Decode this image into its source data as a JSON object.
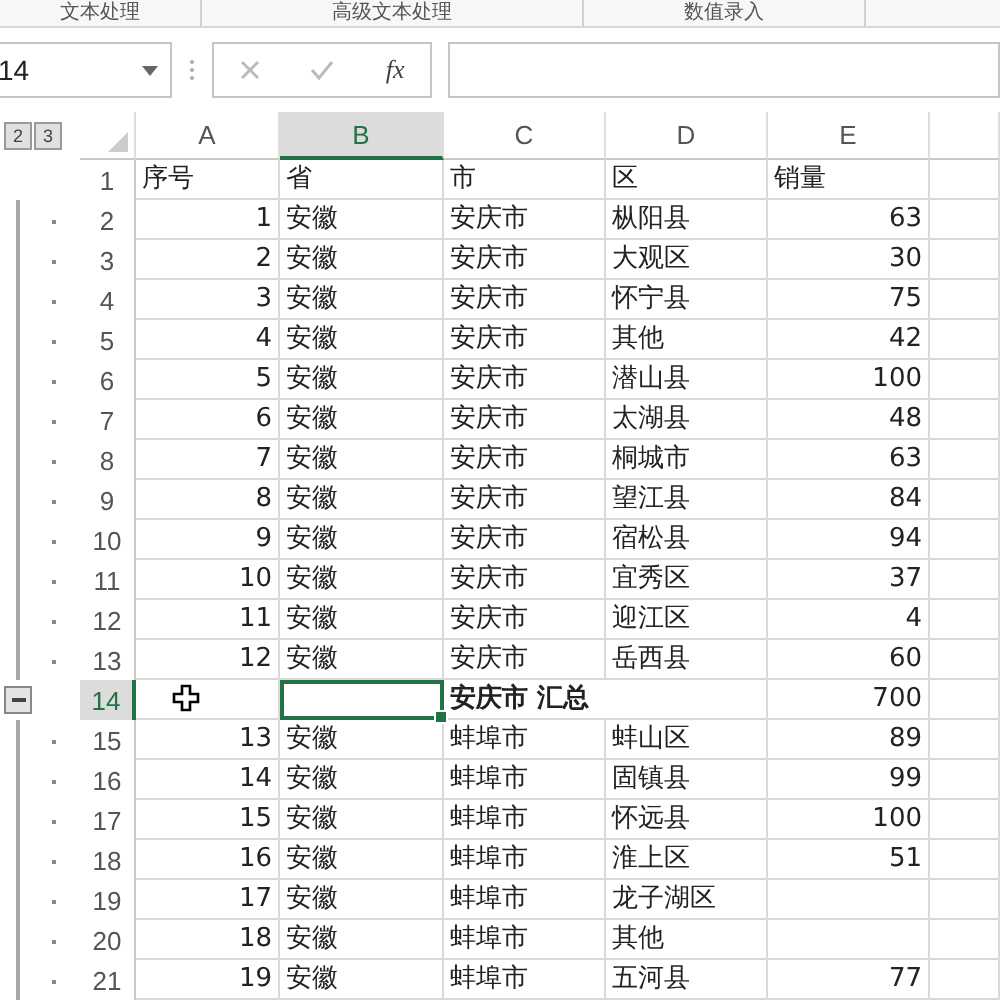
{
  "ribbon_groups": [
    "文本处理",
    "高级文本处理",
    "数值录入"
  ],
  "formula_bar": {
    "name_box": "14",
    "function_label": "fx"
  },
  "outline_levels": [
    "2",
    "3"
  ],
  "columns": [
    {
      "label": "A",
      "selected": false
    },
    {
      "label": "B",
      "selected": true
    },
    {
      "label": "C",
      "selected": false
    },
    {
      "label": "D",
      "selected": false
    },
    {
      "label": "E",
      "selected": false
    }
  ],
  "rows": [
    {
      "n": "1",
      "kind": "header",
      "selected": false,
      "a": "序号",
      "b": "省",
      "c": "市",
      "d": "区",
      "e": "销量"
    },
    {
      "n": "2",
      "kind": "detail",
      "selected": false,
      "a": "1",
      "b": "安徽",
      "c": "安庆市",
      "d": "枞阳县",
      "e": "63"
    },
    {
      "n": "3",
      "kind": "detail",
      "selected": false,
      "a": "2",
      "b": "安徽",
      "c": "安庆市",
      "d": "大观区",
      "e": "30"
    },
    {
      "n": "4",
      "kind": "detail",
      "selected": false,
      "a": "3",
      "b": "安徽",
      "c": "安庆市",
      "d": "怀宁县",
      "e": "75"
    },
    {
      "n": "5",
      "kind": "detail",
      "selected": false,
      "a": "4",
      "b": "安徽",
      "c": "安庆市",
      "d": "其他",
      "e": "42"
    },
    {
      "n": "6",
      "kind": "detail",
      "selected": false,
      "a": "5",
      "b": "安徽",
      "c": "安庆市",
      "d": "潜山县",
      "e": "100"
    },
    {
      "n": "7",
      "kind": "detail",
      "selected": false,
      "a": "6",
      "b": "安徽",
      "c": "安庆市",
      "d": "太湖县",
      "e": "48"
    },
    {
      "n": "8",
      "kind": "detail",
      "selected": false,
      "a": "7",
      "b": "安徽",
      "c": "安庆市",
      "d": "桐城市",
      "e": "63"
    },
    {
      "n": "9",
      "kind": "detail",
      "selected": false,
      "a": "8",
      "b": "安徽",
      "c": "安庆市",
      "d": "望江县",
      "e": "84"
    },
    {
      "n": "10",
      "kind": "detail",
      "selected": false,
      "a": "9",
      "b": "安徽",
      "c": "安庆市",
      "d": "宿松县",
      "e": "94"
    },
    {
      "n": "11",
      "kind": "detail",
      "selected": false,
      "a": "10",
      "b": "安徽",
      "c": "安庆市",
      "d": "宜秀区",
      "e": "37"
    },
    {
      "n": "12",
      "kind": "detail",
      "selected": false,
      "a": "11",
      "b": "安徽",
      "c": "安庆市",
      "d": "迎江区",
      "e": "4"
    },
    {
      "n": "13",
      "kind": "detail",
      "selected": false,
      "a": "12",
      "b": "安徽",
      "c": "安庆市",
      "d": "岳西县",
      "e": "60"
    },
    {
      "n": "14",
      "kind": "subtotal",
      "selected": true,
      "c": "安庆市 汇总",
      "e": "700"
    },
    {
      "n": "15",
      "kind": "detail",
      "selected": false,
      "a": "13",
      "b": "安徽",
      "c": "蚌埠市",
      "d": "蚌山区",
      "e": "89"
    },
    {
      "n": "16",
      "kind": "detail",
      "selected": false,
      "a": "14",
      "b": "安徽",
      "c": "蚌埠市",
      "d": "固镇县",
      "e": "99"
    },
    {
      "n": "17",
      "kind": "detail",
      "selected": false,
      "a": "15",
      "b": "安徽",
      "c": "蚌埠市",
      "d": "怀远县",
      "e": "100"
    },
    {
      "n": "18",
      "kind": "detail",
      "selected": false,
      "a": "16",
      "b": "安徽",
      "c": "蚌埠市",
      "d": "淮上区",
      "e": "51"
    },
    {
      "n": "19",
      "kind": "detail",
      "selected": false,
      "a": "17",
      "b": "安徽",
      "c": "蚌埠市",
      "d": "龙子湖区"
    },
    {
      "n": "20",
      "kind": "detail",
      "selected": false,
      "a": "18",
      "b": "安徽",
      "c": "蚌埠市",
      "d": "其他"
    },
    {
      "n": "21",
      "kind": "detail",
      "selected": false,
      "a": "19",
      "b": "安徽",
      "c": "蚌埠市",
      "d": "五河县",
      "e": "77"
    }
  ]
}
